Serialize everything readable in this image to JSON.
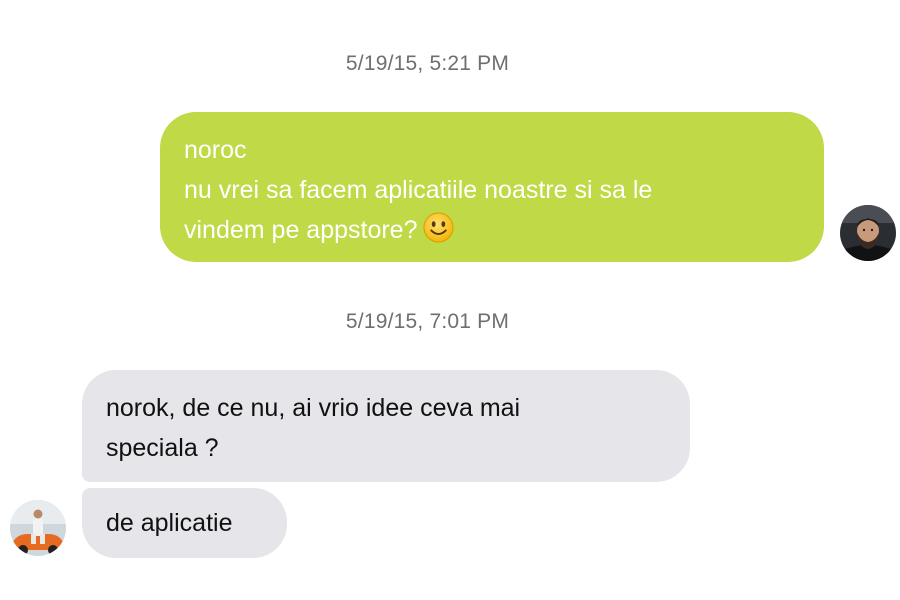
{
  "conversation": {
    "timestamps": [
      "5/19/15, 5:21 PM",
      "5/19/15, 7:01 PM"
    ],
    "outgoing": {
      "lines": [
        "noroc",
        "nu vrei sa facem aplicatiile noastre si sa le",
        "vindem pe appstore?"
      ],
      "emoji": "slightly-smiling-face-emoji"
    },
    "incoming": [
      {
        "lines": [
          "norok, de ce nu, ai vrio idee ceva mai",
          "speciala ?"
        ]
      },
      {
        "lines": [
          "de aplicatie"
        ]
      }
    ]
  },
  "colors": {
    "outgoing_bubble": "#bfd947",
    "incoming_bubble": "#e5e5ea",
    "timestamp_text": "#6e6e73"
  }
}
